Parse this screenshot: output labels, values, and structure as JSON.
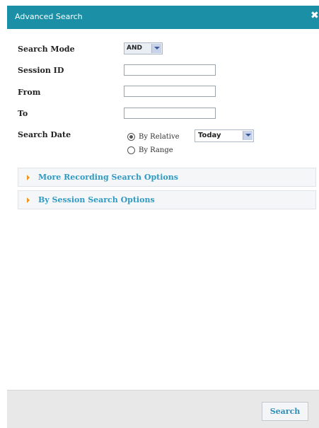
{
  "dialog": {
    "title": "Advanced Search",
    "close_glyph": "✖"
  },
  "form": {
    "search_mode": {
      "label": "Search Mode",
      "value": "AND"
    },
    "session_id": {
      "label": "Session ID",
      "value": ""
    },
    "from": {
      "label": "From",
      "value": ""
    },
    "to": {
      "label": "To",
      "value": ""
    },
    "search_date": {
      "label": "Search Date",
      "by_relative_label": "By Relative",
      "by_range_label": "By Range",
      "relative_value": "Today",
      "selected": "by_relative"
    }
  },
  "accordion": [
    {
      "label": "More Recording Search Options"
    },
    {
      "label": "By Session Search Options"
    }
  ],
  "footer": {
    "search_label": "Search"
  },
  "colors": {
    "titlebar": "#1a8fa5",
    "link": "#2f9bc4",
    "accordion_arrow": "#e99a1e"
  }
}
